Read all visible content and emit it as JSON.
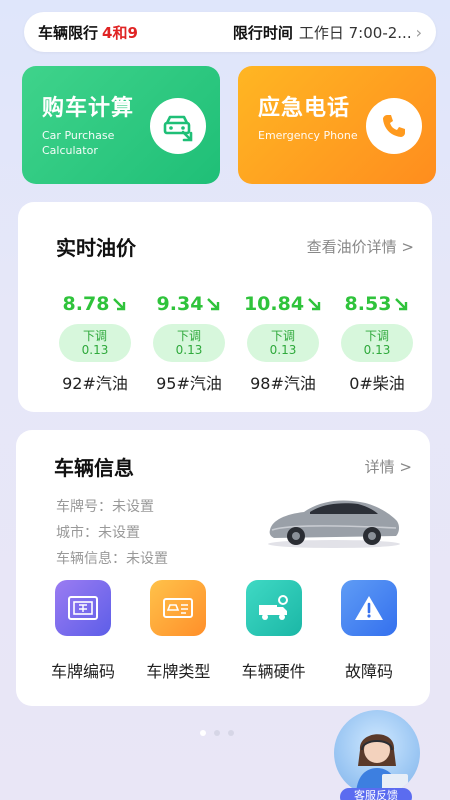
{
  "restriction": {
    "label": "车辆限行",
    "numbers": "4和9",
    "time_label": "限行时间",
    "time_value": "工作日 7:00-2..."
  },
  "features": [
    {
      "title": "购车计算",
      "subtitle_line1": "Car Purchase",
      "subtitle_line2": "Calculator",
      "icon": "car-calculator-icon"
    },
    {
      "title": "应急电话",
      "subtitle_line1": "Emergency Phone",
      "subtitle_line2": "",
      "icon": "phone-icon"
    }
  ],
  "oil": {
    "title": "实时油价",
    "link": "查看油价详情 >",
    "items": [
      {
        "price": "8.78",
        "trend": "下调",
        "change": "0.13",
        "name": "92#汽油"
      },
      {
        "price": "9.34",
        "trend": "下调",
        "change": "0.13",
        "name": "95#汽油"
      },
      {
        "price": "10.84",
        "trend": "下调",
        "change": "0.13",
        "name": "98#汽油"
      },
      {
        "price": "8.53",
        "trend": "下调",
        "change": "0.13",
        "name": "0#柴油"
      }
    ],
    "trend_color": "#2fc33b"
  },
  "vehicle": {
    "title": "车辆信息",
    "link": "详情 >",
    "plate": "车牌号：未设置",
    "city": "城市：未设置",
    "info": "车辆信息：未设置",
    "tools": [
      {
        "label": "车牌编码",
        "icon": "license-plate-icon"
      },
      {
        "label": "车牌类型",
        "icon": "plate-type-icon"
      },
      {
        "label": "车辆硬件",
        "icon": "vehicle-hardware-icon"
      },
      {
        "label": "故障码",
        "icon": "warning-icon"
      }
    ]
  },
  "pager": {
    "pages": 3,
    "active": 1
  },
  "support": {
    "label": "客服反馈"
  },
  "colors": {
    "green": "#1fbf77",
    "orange": "#ff8d1e",
    "price_green": "#2fc33b",
    "restrict_red": "#e02424"
  }
}
